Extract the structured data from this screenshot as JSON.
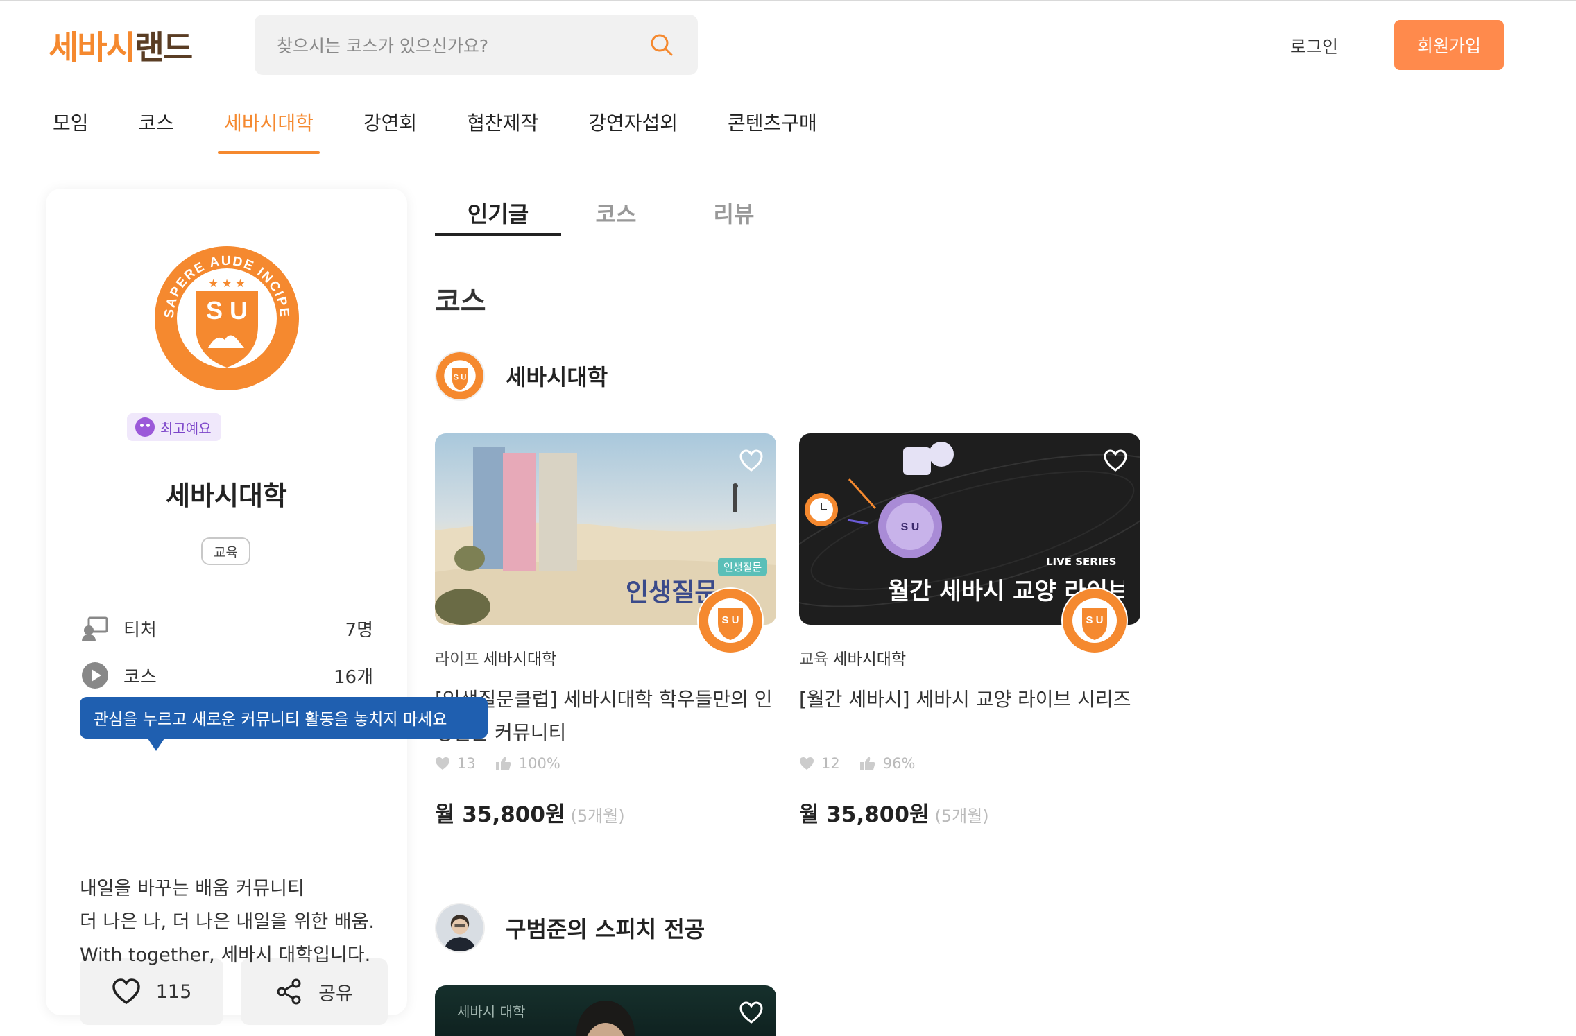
{
  "header": {
    "logo_part1": "세바시",
    "logo_part2": "랜드",
    "search_placeholder": "찾으시는 코스가 있으신가요?",
    "login_label": "로그인",
    "signup_label": "회원가입"
  },
  "nav": {
    "items": [
      "모임",
      "코스",
      "세바시대학",
      "강연회",
      "협찬제작",
      "강연자섭외",
      "콘텐츠구매"
    ],
    "active": "세바시대학"
  },
  "profile": {
    "badge": "최고예요",
    "name": "세바시대학",
    "category": "교육",
    "stats": [
      {
        "label": "티처",
        "value": "7명",
        "icon": "teacher-icon"
      },
      {
        "label": "코스",
        "value": "16개",
        "icon": "play-icon"
      }
    ],
    "tooltip": "관심을 누르고 새로운 커뮤니티 활동을 놓치지 마세요",
    "like_count": "115",
    "share_label": "공유",
    "description": [
      "내일을 바꾸는 배움 커뮤니티",
      "더 나은 나, 더 나은 내일을 위한 배움.",
      "With together, 세바시 대학입니다."
    ]
  },
  "content_tabs": [
    "인기글",
    "코스",
    "리뷰"
  ],
  "section_title": "코스",
  "hosts": [
    {
      "name": "세바시대학",
      "courses": [
        {
          "thumb_text": "인생질문",
          "thumb_tag": "인생질문",
          "category": "라이프",
          "host": "세바시대학",
          "title": "[인생질문클럽] 세바시대학 학우들만의 인생질문 커뮤니티",
          "likes": "13",
          "rating": "100%",
          "price": "월 35,800원",
          "period": "(5개월)"
        },
        {
          "thumb_text": "월간 세바시 교양 라이브",
          "thumb_tag": "LIVE SERIES",
          "category": "교육",
          "host": "세바시대학",
          "title": "[월간 세바시] 세바시 교양 라이브 시리즈",
          "likes": "12",
          "rating": "96%",
          "price": "월 35,800원",
          "period": "(5개월)"
        }
      ]
    },
    {
      "name": "구범준의 스피치 전공",
      "courses": [
        {
          "thumb_text": "세바시 대학"
        }
      ]
    }
  ],
  "colors": {
    "accent": "#f5892f",
    "signup": "#ff8a4c",
    "tooltip": "#1f5fb0",
    "badge_text": "#7c45c9"
  }
}
